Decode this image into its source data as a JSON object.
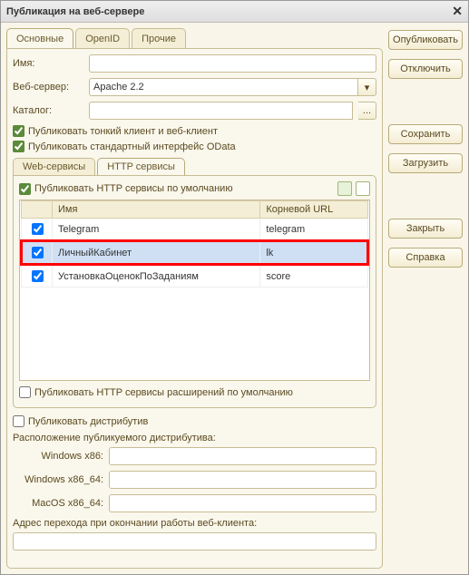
{
  "title": "Публикация на веб-сервере",
  "tabs": {
    "main": "Основные",
    "openid": "OpenID",
    "other": "Прочие"
  },
  "fields": {
    "name_label": "Имя:",
    "name_value": "",
    "webserver_label": "Веб-сервер:",
    "webserver_value": "Apache 2.2",
    "catalog_label": "Каталог:",
    "catalog_value": "",
    "catalog_btn": "..."
  },
  "checks": {
    "thin_client": "Публиковать тонкий клиент и веб-клиент",
    "odata": "Публиковать стандартный интерфейс OData"
  },
  "inner_tabs": {
    "web": "Web-сервисы",
    "http": "HTTP сервисы"
  },
  "http_default": "Публиковать HTTP сервисы по умолчанию",
  "table": {
    "col_check": "",
    "col_name": "Имя",
    "col_url": "Корневой URL",
    "rows": [
      {
        "checked": true,
        "name": "Telegram",
        "url": "telegram"
      },
      {
        "checked": true,
        "name": "ЛичныйКабинет",
        "url": "lk"
      },
      {
        "checked": true,
        "name": "УстановкаОценокПоЗаданиям",
        "url": "score"
      }
    ]
  },
  "http_ext": "Публиковать HTTP сервисы расширений по умолчанию",
  "dist": {
    "publish": "Публиковать дистрибутив",
    "location": "Расположение публикуемого дистрибутива:",
    "win86": "Windows x86:",
    "win64": "Windows x86_64:",
    "mac64": "MacOS x86_64:"
  },
  "redirect_label": "Адрес перехода при окончании работы веб-клиента:",
  "buttons": {
    "publish": "Опубликовать",
    "disconnect": "Отключить",
    "save": "Сохранить",
    "load": "Загрузить",
    "close": "Закрыть",
    "help": "Справка"
  }
}
